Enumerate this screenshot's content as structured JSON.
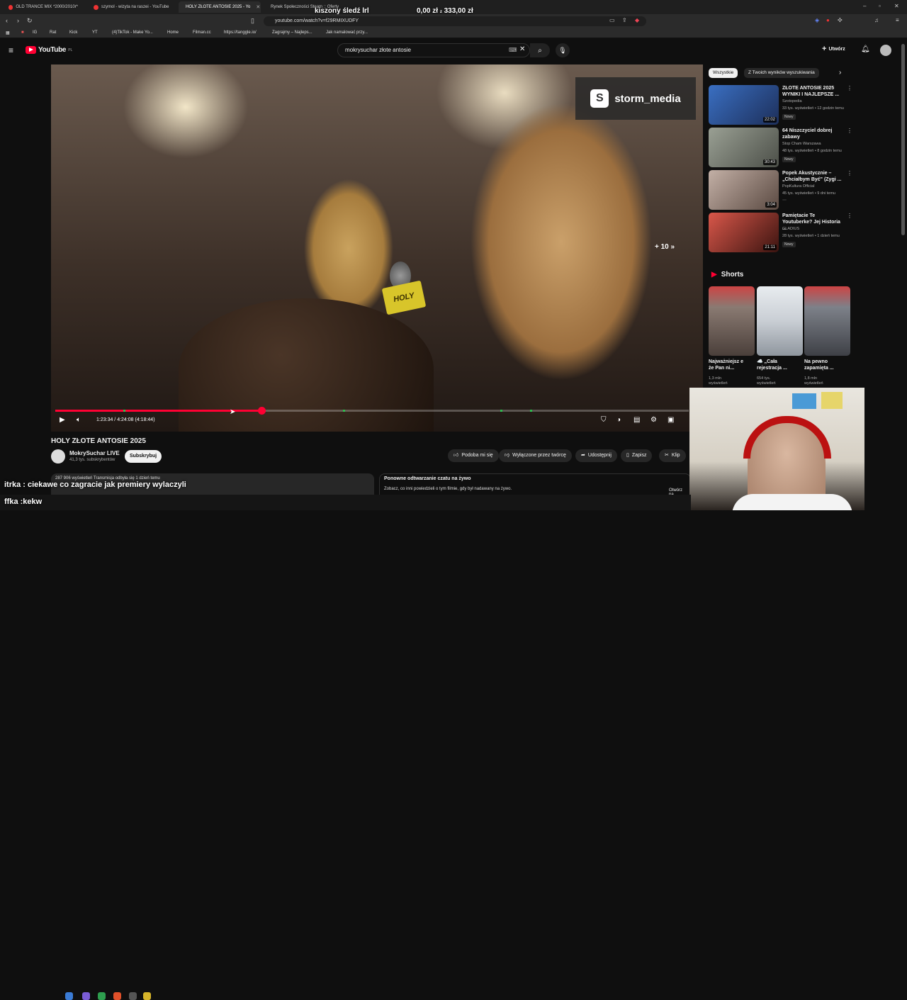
{
  "browser": {
    "tabs": [
      {
        "label": "OLD TRANCE MIX *2000/2010r*",
        "active": false
      },
      {
        "label": "szymol - wizyta na raszei - YouTube",
        "active": false
      },
      {
        "label": "HOLY ZŁOTE ANTOSIE 2025 - Yo",
        "active": true
      },
      {
        "label": "Rynek Społeczności Steam :: Oferty",
        "active": false
      }
    ],
    "url": "youtube.com/watch?v=f29RMIXUDFY",
    "bookmarks": [
      "IG",
      "Rat",
      "Kick",
      "YT",
      "(4)TikTok - Make Yo...",
      "Home",
      "Filman.cc",
      "https://tanggle.io/",
      "Zagrajmy – Najleps...",
      "Jak namalować przy..."
    ]
  },
  "overlay": {
    "top_text": "kiszony śledź lrl",
    "money": "0,00 zł",
    "money_sep": "z",
    "money_goal": "333,00 zł",
    "chat_line": "itrka : ciekawe co zagracie jak premiery wylaczyli",
    "chat_user2": "ffka :kekw"
  },
  "youtube": {
    "logo": "YouTube",
    "logo_region": "PL",
    "search_value": "mokrysuchar złote antosie",
    "create_label": "Utwórz"
  },
  "video": {
    "brand": "storm_media",
    "skip_label": "+ 10",
    "flag_text": "HOLY",
    "time_current": "1:23:34",
    "time_total": "4:24:08",
    "time_remaining": "(4:18:44)",
    "progress": 0.325,
    "title": "HOLY ZŁOTE ANTOSIE 2025",
    "channel": "MokrySuchar LIVE",
    "subscribers": "41,3 tys. subskrybentów",
    "subscribe_label": "Subskrybuj",
    "actions": [
      "Podoba mi się",
      "Wyłączone przez twórcę",
      "Udostępnij",
      "Zapisz",
      "Klip"
    ],
    "desc_stats": "287 906 wyświetleń  Transmisja odbyła się 1 dzień temu",
    "chat_replay_title": "Ponowne odtwarzanie czatu na żywo",
    "chat_replay_sub": "Zobacz, co inni powiedzieli o tym filmie, gdy był nadawany na żywo.",
    "chat_replay_open": "Otwórz pa..."
  },
  "sidebar": {
    "chips": [
      "Wszystkie",
      "Z Twoich wyników wyszukiwania"
    ],
    "recommendations": [
      {
        "title": "ZŁOTE ANTOSIE 2025 WYNIKI I NAJLEPSZE ...",
        "channel": "Szotopedia",
        "meta": "33 tys. wyświetleń • 12 godzin temu",
        "badge": "Nowy",
        "duration": "22:02",
        "color": "#3a6fc2"
      },
      {
        "title": "64 Niszczyciel dobrej zabawy",
        "channel": "Stop Cham Warszawa",
        "meta": "48 tys. wyświetleń • 8 godzin temu",
        "badge": "Nowy",
        "duration": "30:43",
        "color": "#7b7f77"
      },
      {
        "title": "Popek Akustycznie – „Chciałbym Być\" (Zygi ...",
        "channel": "PopKultura Official",
        "meta": "45 tys. wyświetleń • 9 dni temu",
        "badge": "",
        "duration": "3:04",
        "color": "#9a8378"
      },
      {
        "title": "Pamiętacie Te Youtuberke? Jej Historia ...",
        "channel": "GLADIUS",
        "meta": "28 tys. wyświetleń • 1 dzień temu",
        "badge": "Nowy",
        "duration": "21:11",
        "color": "#b8443a"
      }
    ],
    "shorts_label": "Shorts",
    "shorts": [
      {
        "title": "Najważniejsz e że Pan ni...",
        "views": "1,3 mln wyświetleń",
        "color": "#8a7a72"
      },
      {
        "title": "☁️ „Cała rejestracja ...",
        "views": "654 tys. wyświetleń",
        "color": "#c9ced4"
      },
      {
        "title": "Na pewno zapamięta ...",
        "views": "1,8 mln wyświetleń",
        "color": "#7d8189"
      }
    ]
  },
  "colors": {
    "accent": "#ff0033",
    "chapter": "#2dbd4e",
    "bg": "#0f0f0f"
  }
}
